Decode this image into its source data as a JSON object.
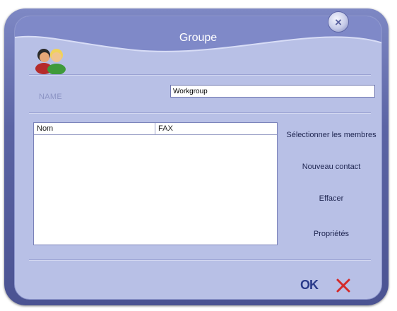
{
  "window": {
    "title": "Groupe"
  },
  "form": {
    "name_label": "NAME",
    "name_value": "Workgroup"
  },
  "list": {
    "columns": [
      "Nom",
      "FAX"
    ],
    "rows": []
  },
  "actions": {
    "select_members": "Sélectionner les membres",
    "new_contact": "Nouveau contact",
    "delete": "Effacer",
    "properties": "Propriétés"
  },
  "footer": {
    "ok_label": "OK"
  },
  "icons": {
    "close": "close-icon",
    "group": "group-icon",
    "cancel": "cancel-x-icon"
  },
  "colors": {
    "frame": "#5b64a4",
    "panel": "#b8c0e6",
    "ok": "#2a3a8a",
    "cancel": "#d42a2a"
  }
}
